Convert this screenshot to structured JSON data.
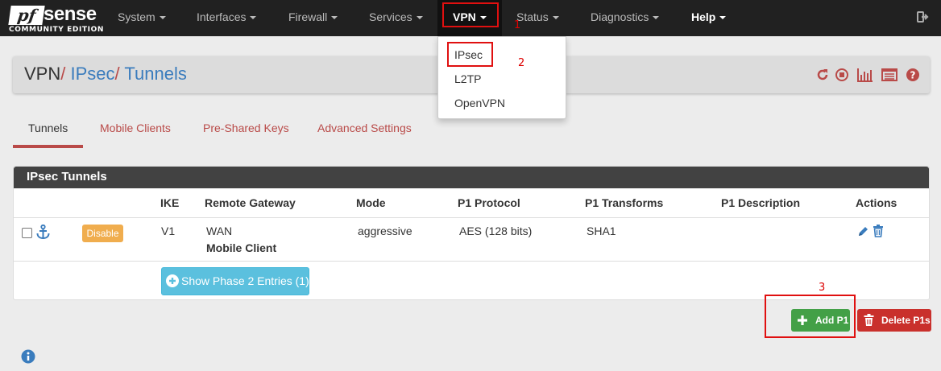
{
  "brand": {
    "name_pf": "pf",
    "name_sense": "sense",
    "edition": "COMMUNITY EDITION"
  },
  "nav": {
    "items": [
      "System",
      "Interfaces",
      "Firewall",
      "Services",
      "VPN",
      "Status",
      "Diagnostics",
      "Help"
    ],
    "active": "VPN"
  },
  "vpn_menu": {
    "items": [
      "IPsec",
      "L2TP",
      "OpenVPN"
    ]
  },
  "annotations": {
    "one": "1",
    "two": "2",
    "three": "3"
  },
  "breadcrumb": {
    "root": "VPN",
    "sep": "/",
    "level1": "IPsec",
    "level2": "Tunnels"
  },
  "tabs": [
    "Tunnels",
    "Mobile Clients",
    "Pre-Shared Keys",
    "Advanced Settings"
  ],
  "panel": {
    "title": "IPsec Tunnels",
    "columns": [
      "IKE",
      "Remote Gateway",
      "Mode",
      "P1 Protocol",
      "P1 Transforms",
      "P1 Description",
      "Actions"
    ],
    "row": {
      "status_badge": "Disable",
      "ike": "V1",
      "remote_gateway": "WAN",
      "remote_gateway_sub": "Mobile Client",
      "mode": "aggressive",
      "p1_protocol": "AES (128 bits)",
      "p1_transforms": "SHA1",
      "p1_description": ""
    },
    "show_phase2_label": "Show Phase 2 Entries (1)"
  },
  "buttons": {
    "add_p1": "Add P1",
    "delete_p1s": "Delete P1s"
  },
  "colors": {
    "navbar": "#212121",
    "accent": "#b94a48",
    "link": "#3a7cbd",
    "success": "#43a047",
    "danger": "#c9302c",
    "info": "#5bc0de",
    "warning": "#f0ad4e",
    "annotation": "#e01010"
  }
}
